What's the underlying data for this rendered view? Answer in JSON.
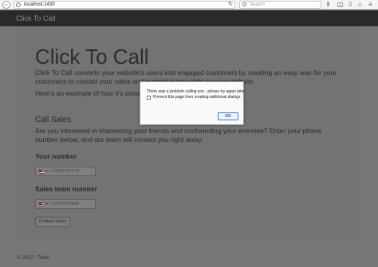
{
  "browser": {
    "url": "localhost:1430",
    "search_placeholder": "Search",
    "back_glyph": "←",
    "reload_glyph": "↻",
    "icons": [
      "info-icon",
      "search-icon",
      "library-icon",
      "pocket-icon",
      "download-icon",
      "home-icon",
      "menu-icon"
    ]
  },
  "navbar": {
    "brand": "Click To Call"
  },
  "main": {
    "title": "Click To Call",
    "intro": "Click To Call converts your website's users into engaged customers by creating an easy way for your customers to contact your sales and support teams right on your website.",
    "example": "Here's an example of how it's done!",
    "sales_heading": "Call Sales",
    "sales_paragraph": "Are you interested in impressing your friends and confounding your enemies? Enter your phone number below, and our team will contact you right away.",
    "your_number_label": "Your number",
    "your_number_value": "+15002752273",
    "sales_number_label": "Sales team number",
    "sales_number_value": "+15057267864",
    "contact_button": "Contact Sales",
    "flag_caret": "▾"
  },
  "footer": {
    "text": "© 2017 · Twilio"
  },
  "dialog": {
    "message": "There was a problem calling you - please try again later.",
    "checkbox_label": "Prevent this page from creating additional dialogs",
    "ok_label": "OK"
  },
  "colors": {
    "navbar": "#2a2a2a",
    "overlay": "#777777",
    "ok_border": "#3c7fd8"
  }
}
